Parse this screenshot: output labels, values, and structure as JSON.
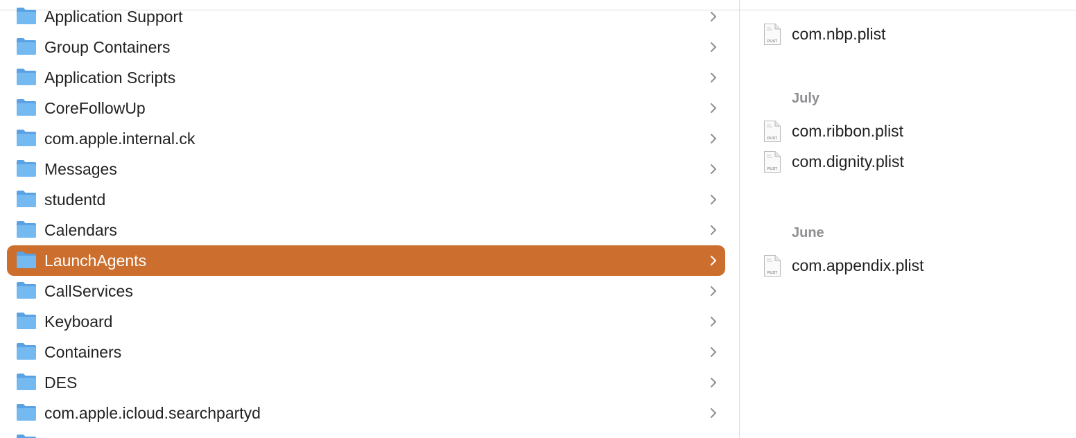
{
  "folders": [
    {
      "label": "Application Support"
    },
    {
      "label": "Group Containers"
    },
    {
      "label": "Application Scripts"
    },
    {
      "label": "CoreFollowUp"
    },
    {
      "label": "com.apple.internal.ck"
    },
    {
      "label": "Messages"
    },
    {
      "label": "studentd"
    },
    {
      "label": "Calendars"
    },
    {
      "label": "LaunchAgents",
      "selected": true
    },
    {
      "label": "CallServices"
    },
    {
      "label": "Keyboard"
    },
    {
      "label": "Containers"
    },
    {
      "label": "DES"
    },
    {
      "label": "com.apple.icloud.searchpartyd"
    },
    {
      "label": ""
    }
  ],
  "file_icon_caption": "PLIST",
  "file_groups": [
    {
      "header": "",
      "files": [
        {
          "label": "com.nbp.plist"
        }
      ]
    },
    {
      "header": "July",
      "files": [
        {
          "label": "com.ribbon.plist"
        },
        {
          "label": "com.dignity.plist"
        }
      ]
    },
    {
      "header": "June",
      "files": [
        {
          "label": "com.appendix.plist"
        }
      ]
    }
  ],
  "colors": {
    "selection": "#cc6e2d",
    "folder_body": "#74b9f0",
    "folder_tab": "#5aa2e3",
    "chevron": "#8e8e93",
    "group_header": "#8e8e93"
  },
  "icons": {
    "folder": "folder-icon",
    "chevron": "chevron-right-icon",
    "plist": "plist-file-icon"
  }
}
